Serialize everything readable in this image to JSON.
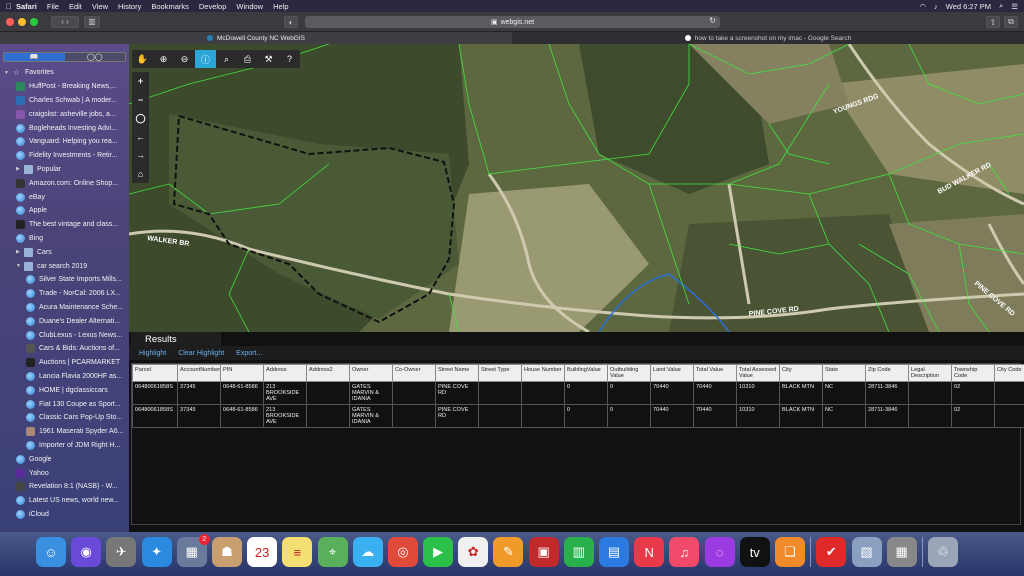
{
  "menubar": {
    "app": "Safari",
    "items": [
      "File",
      "Edit",
      "View",
      "History",
      "Bookmarks",
      "Develop",
      "Window",
      "Help"
    ],
    "clock": "Wed 6:27 PM"
  },
  "toolbar": {
    "url": "webgis.net"
  },
  "tabs": [
    {
      "title": "McDowell County NC WebGIS",
      "active": true
    },
    {
      "title": "how to take a screenshot on my imac - Google Search",
      "active": false
    }
  ],
  "sidebar": {
    "items": [
      {
        "label": "Favorites",
        "level": 0,
        "icon": "star-icon",
        "kind": "group"
      },
      {
        "label": "HuffPost - Breaking News,...",
        "level": 1,
        "icon": "huffpost-icon",
        "color": "#2b8a5a"
      },
      {
        "label": "Charles Schwab | A moder...",
        "level": 1,
        "icon": "schwab-icon",
        "color": "#2a6fb8"
      },
      {
        "label": "craigslist: asheville jobs, a...",
        "level": 1,
        "icon": "craigslist-icon",
        "color": "#8855aa"
      },
      {
        "label": "Bogleheads Investing Advi...",
        "level": 1,
        "icon": "globe-icon"
      },
      {
        "label": "Vanguard: Helping you rea...",
        "level": 1,
        "icon": "globe-icon"
      },
      {
        "label": "Fidelity Investments - Retir...",
        "level": 1,
        "icon": "globe-icon"
      },
      {
        "label": "Popular",
        "level": 1,
        "icon": "folder-icon",
        "kind": "folder"
      },
      {
        "label": "Amazon.com: Online Shop...",
        "level": 1,
        "icon": "amazon-icon",
        "color": "#333"
      },
      {
        "label": "eBay",
        "level": 1,
        "icon": "globe-icon"
      },
      {
        "label": "Apple",
        "level": 1,
        "icon": "globe-icon"
      },
      {
        "label": "The best vintage and class...",
        "level": 1,
        "icon": "bat-icon",
        "color": "#222"
      },
      {
        "label": "Bing",
        "level": 1,
        "icon": "globe-icon"
      },
      {
        "label": "Cars",
        "level": 1,
        "icon": "folder-icon",
        "kind": "folder"
      },
      {
        "label": "car search 2019",
        "level": 1,
        "icon": "folder-icon",
        "kind": "folder-open"
      },
      {
        "label": "Silver State Imports Mills...",
        "level": 2,
        "icon": "globe-icon"
      },
      {
        "label": "Trade - NorCal: 2006 LX...",
        "level": 2,
        "icon": "globe-icon"
      },
      {
        "label": "Acura Maintenance Sche...",
        "level": 2,
        "icon": "globe-icon"
      },
      {
        "label": "Duane's Dealer Alternati...",
        "level": 2,
        "icon": "globe-icon"
      },
      {
        "label": "ClubLexus - Lexus News...",
        "level": 2,
        "icon": "globe-icon"
      },
      {
        "label": "Cars & Bids: Auctions of...",
        "level": 2,
        "icon": "carsbids-icon",
        "color": "#555"
      },
      {
        "label": "Auctions | PCARMARKET",
        "level": 2,
        "icon": "pcar-icon",
        "color": "#222"
      },
      {
        "label": "Lancia Flavia 2000HF as...",
        "level": 2,
        "icon": "globe-icon"
      },
      {
        "label": "HOME | dgclassiccars",
        "level": 2,
        "icon": "globe-icon"
      },
      {
        "label": "Fiat 130 Coupe as Sport...",
        "level": 2,
        "icon": "globe-icon"
      },
      {
        "label": "Classic Cars Pop-Up Sto...",
        "level": 2,
        "icon": "globe-icon"
      },
      {
        "label": "1961 Maserati Spyder A6...",
        "level": 2,
        "icon": "photo-icon",
        "color": "#a87"
      },
      {
        "label": "Importer of JDM Right H...",
        "level": 2,
        "icon": "globe-icon"
      },
      {
        "label": "Google",
        "level": 1,
        "icon": "globe-icon"
      },
      {
        "label": "Yahoo",
        "level": 1,
        "icon": "yahoo-icon",
        "color": "#5a2a9a"
      },
      {
        "label": "Revelation 8:1 (NASB) - W...",
        "level": 1,
        "icon": "bible-icon",
        "color": "#444"
      },
      {
        "label": "Latest US news, world new...",
        "level": 1,
        "icon": "globe-icon"
      },
      {
        "label": "iCloud",
        "level": 1,
        "icon": "globe-icon"
      }
    ]
  },
  "map": {
    "road_labels": [
      "WALKER BR",
      "YOUNGS RDG",
      "BUD WALKER RD",
      "PINE COVE RD",
      "PINE COVE RD"
    ],
    "colors": {
      "parcel_line": "#3fe33f",
      "highlight": "#111111",
      "stream": "#2a6fd8"
    }
  },
  "results": {
    "title": "Results",
    "links": [
      "Highlight",
      "Clear Highlight",
      "Export..."
    ],
    "columns": [
      "Parcel",
      "AccountNumber",
      "PIN",
      "Address",
      "Address2",
      "Owner",
      "Co-Owner",
      "Street Name",
      "Street Type",
      "House Number",
      "BuildingValue",
      "Outbuilding Value",
      "Land Value",
      "Total Value",
      "Total Assessed Value",
      "City",
      "State",
      "Zip Code",
      "Legal Description",
      "Township Code",
      "City Code"
    ],
    "rows": [
      [
        "06480061858S",
        "37345",
        "0648-61-8586",
        "213 BROOKSIDE AVE",
        "",
        "GATES MARVIN & IDANIA",
        "",
        "PINE COVE RD",
        "",
        "",
        "0",
        "0",
        "70440",
        "70440",
        "10310",
        "BLACK MTN",
        "NC",
        "28711-3846",
        "",
        "02",
        ""
      ],
      [
        "06480061858S",
        "37345",
        "0648-61-8586",
        "213 BROOKSIDE AVE",
        "",
        "GATES MARVIN & IDANIA",
        "",
        "PINE COVE RD",
        "",
        "",
        "0",
        "0",
        "70440",
        "70440",
        "10310",
        "BLACK MTN",
        "NC",
        "28711-3846",
        "",
        "02",
        ""
      ]
    ]
  },
  "dock": {
    "apps": [
      {
        "name": "finder-icon",
        "color": "#3a8fe0",
        "glyph": "☺"
      },
      {
        "name": "siri-icon",
        "color": "#6a4ad8",
        "glyph": "◉"
      },
      {
        "name": "launchpad-icon",
        "color": "#777",
        "glyph": "✈"
      },
      {
        "name": "safari-icon",
        "color": "#2a8ae0",
        "glyph": "✦"
      },
      {
        "name": "photo-browser-icon",
        "color": "#6a7a9a",
        "glyph": "▦",
        "badge": "2"
      },
      {
        "name": "contacts-icon",
        "color": "#c8a070",
        "glyph": "☗"
      },
      {
        "name": "calendar-icon",
        "color": "#ffffff",
        "glyph": "23"
      },
      {
        "name": "notes-icon",
        "color": "#f4e070",
        "glyph": "≡"
      },
      {
        "name": "maps-icon",
        "color": "#5ab05a",
        "glyph": "⌖"
      },
      {
        "name": "messages-icon",
        "color": "#3ab0f0",
        "glyph": "☁"
      },
      {
        "name": "chrome-icon",
        "color": "#e04a3a",
        "glyph": "◎"
      },
      {
        "name": "facetime-icon",
        "color": "#2ac04a",
        "glyph": "▶"
      },
      {
        "name": "photos-icon",
        "color": "#f0f0f0",
        "glyph": "✿"
      },
      {
        "name": "pages-icon",
        "color": "#f09a2a",
        "glyph": "✎"
      },
      {
        "name": "photo-booth-icon",
        "color": "#c02a2a",
        "glyph": "▣"
      },
      {
        "name": "numbers-icon",
        "color": "#2ab04a",
        "glyph": "▥"
      },
      {
        "name": "keynote-icon",
        "color": "#2a7ae0",
        "glyph": "▤"
      },
      {
        "name": "news-icon",
        "color": "#e83a4a",
        "glyph": "N"
      },
      {
        "name": "music-icon",
        "color": "#f04a6a",
        "glyph": "♫"
      },
      {
        "name": "podcasts-icon",
        "color": "#9a3ae0",
        "glyph": "◌"
      },
      {
        "name": "apple-tv-icon",
        "color": "#111111",
        "glyph": "tv"
      },
      {
        "name": "books-icon",
        "color": "#f08a2a",
        "glyph": "❏"
      },
      {
        "name": "todo-icon",
        "color": "#e02a2a",
        "glyph": "✔"
      },
      {
        "name": "preview-icon",
        "color": "#8aa0c0",
        "glyph": "▧"
      },
      {
        "name": "calculator-icon",
        "color": "#888888",
        "glyph": "▦"
      },
      {
        "name": "trash-icon",
        "color": "#9aa6b8",
        "glyph": "♲"
      }
    ]
  }
}
